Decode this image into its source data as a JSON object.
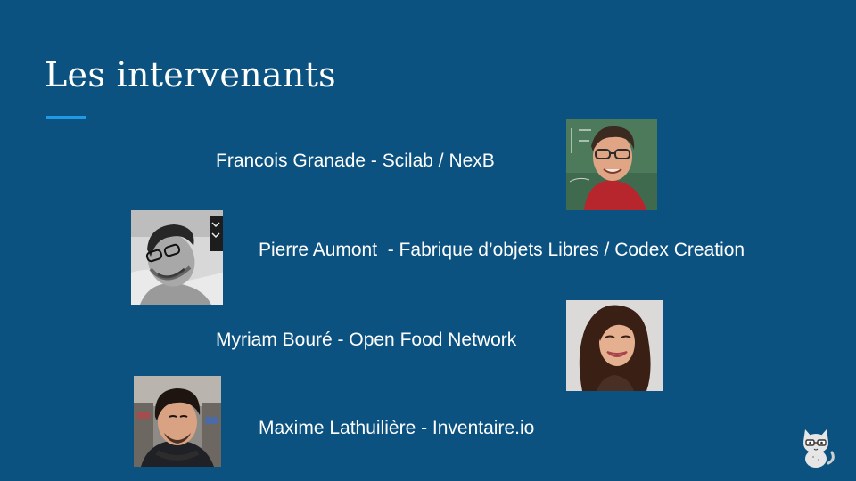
{
  "slide": {
    "title": "Les intervenants",
    "colors": {
      "background": "#0b5281",
      "accent": "#1e9ae6",
      "text": "#ffffff"
    }
  },
  "speakers": [
    {
      "label": "Francois Granade - Scilab / NexB",
      "photo": "photo-francois-granade"
    },
    {
      "label": "Pierre Aumont  - Fabrique d’objets Libres / Codex Creation",
      "photo": "photo-pierre-aumont"
    },
    {
      "label": "Myriam Bouré - Open Food Network",
      "photo": "photo-myriam-boure"
    },
    {
      "label": "Maxime Lathuilière - Inventaire.io",
      "photo": "photo-maxime-lathuiliere"
    }
  ],
  "footer": {
    "logo_icon": "cat-logo-icon"
  }
}
